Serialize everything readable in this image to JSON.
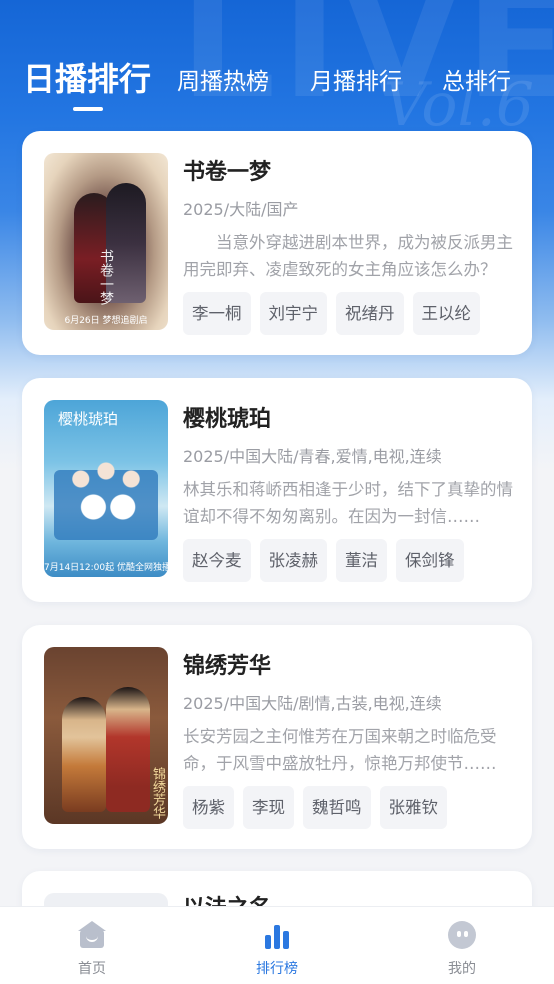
{
  "tabs": [
    {
      "label": "日播排行",
      "active": true
    },
    {
      "label": "周播热榜",
      "active": false
    },
    {
      "label": "月播排行",
      "active": false
    },
    {
      "label": "总排行",
      "active": false
    }
  ],
  "items": [
    {
      "title": "书卷一梦",
      "meta": "2025/大陆/国产",
      "desc": "　　当意外穿越进剧本世界，成为被反派男主用完即弃、凌虐致死的女主角应该怎么办？",
      "poster_caption": "6月26日 梦想追剧启",
      "poster_title": "书卷一梦",
      "cast": [
        "李一桐",
        "刘宇宁",
        "祝绪丹",
        "王以纶"
      ]
    },
    {
      "title": "樱桃琥珀",
      "meta": "2025/中国大陆/青春,爱情,电视,连续",
      "desc": "林其乐和蒋峤西相逢于少时，结下了真挚的情谊却不得不匆匆离别。在因为一封信……",
      "poster_caption": "7月14日12:00起 优酷全网独播",
      "poster_title": "樱桃琥珀",
      "cast": [
        "赵今麦",
        "张凌赫",
        "董洁",
        "保剑锋"
      ]
    },
    {
      "title": "锦绣芳华",
      "meta": "2025/中国大陆/剧情,古装,电视,连续",
      "desc": "长安芳园之主何惟芳在万国来朝之时临危受命，于风雪中盛放牡丹，惊艳万邦使节……",
      "poster_caption": "",
      "poster_title": "锦绣芳华",
      "cast": [
        "杨紫",
        "李现",
        "魏哲鸣",
        "张雅钦"
      ]
    },
    {
      "title": "以法之名",
      "cast": []
    }
  ],
  "nav": [
    {
      "label": "首页",
      "icon": "home-icon",
      "active": false
    },
    {
      "label": "排行榜",
      "icon": "bar-chart-icon",
      "active": true
    },
    {
      "label": "我的",
      "icon": "profile-icon",
      "active": false
    }
  ],
  "colors": {
    "accent": "#2b78e0",
    "header": "#1566d6",
    "background": "#f3f4f7"
  }
}
